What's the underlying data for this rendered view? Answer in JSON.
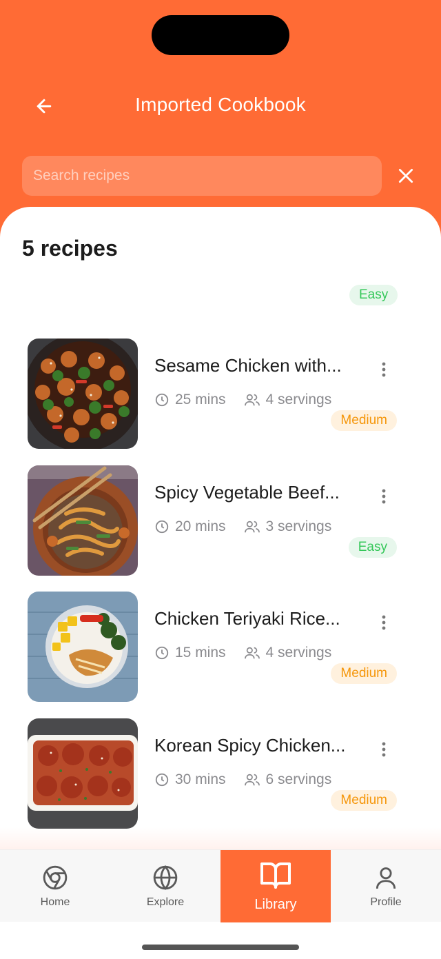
{
  "colors": {
    "accent": "#FF6B35",
    "easy": "#34C759",
    "medium": "#F5960A"
  },
  "header": {
    "title": "Imported Cookbook",
    "back_icon": "arrow-left-icon",
    "search_placeholder": "Search recipes",
    "close_icon": "close-icon"
  },
  "list": {
    "count_label": "5 recipes",
    "top_badge": "Easy",
    "recipes": [
      {
        "title": "Sesame Chicken with...",
        "time": "25 mins",
        "servings": "4 servings",
        "difficulty": "Medium"
      },
      {
        "title": "Spicy Vegetable Beef...",
        "time": "20 mins",
        "servings": "3 servings",
        "difficulty": "Easy"
      },
      {
        "title": "Chicken Teriyaki Rice...",
        "time": "15 mins",
        "servings": "4 servings",
        "difficulty": "Medium"
      },
      {
        "title": "Korean Spicy Chicken...",
        "time": "30 mins",
        "servings": "6 servings",
        "difficulty": "Medium"
      }
    ]
  },
  "tabbar": {
    "tabs": [
      {
        "label": "Home",
        "icon": "chrome-icon"
      },
      {
        "label": "Explore",
        "icon": "globe-icon"
      },
      {
        "label": "Library",
        "icon": "book-open-icon",
        "active": true
      },
      {
        "label": "Profile",
        "icon": "user-icon"
      }
    ]
  }
}
